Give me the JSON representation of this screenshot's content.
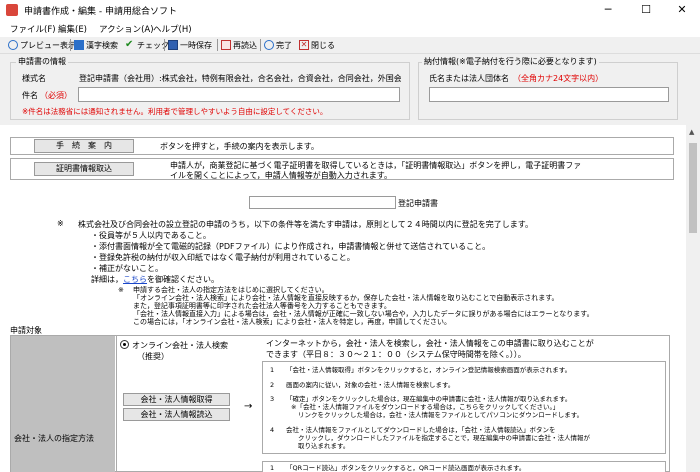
{
  "window": {
    "title": "申請書作成・編集 - 申請用総合ソフト",
    "minimize": "─",
    "maximize": "☐",
    "close": "✕"
  },
  "menu": [
    "ファイル(F)",
    "編集(E)",
    "アクション(A)",
    "ヘルプ(H)"
  ],
  "toolbar": {
    "preview": "プレビュー表示",
    "kanji": "漢字検索",
    "check": "チェック",
    "save": "一時保存",
    "reload": "再読込",
    "done": "完了",
    "close": "閉じる"
  },
  "applicant_info": {
    "legend": "申請書の情報",
    "form_name_label": "様式名",
    "form_name_value": "登記申請書（会社用）:株式会社，特例有限会社，合名会社，合資会社，合同会社，外国会社",
    "subject_label": "件名",
    "required": "（必須）",
    "subject_value": "",
    "note": "※件名は法務省には通知されません。利用者で管理しやすいよう自由に設定してください。"
  },
  "payment_info": {
    "legend": "納付情報(※電子納付を行う際に必要となります)",
    "name_label": "氏名または法人団体名",
    "name_hint": "（全角カナ24文字以内）",
    "name_value": ""
  },
  "content": {
    "guide_button": "手　続　案　内",
    "guide_text": "ボタンを押すと，手続の案内を表示します。",
    "cert_button": "証明書情報取込",
    "cert_text_1": "申請人が，商業登記に基づく電子証明書を取得しているときは，「証明書情報取込」ボタンを押し，電子証明書ファ",
    "cert_text_2": "イルを開くことによって，申請人情報等が自動入力されます。",
    "registration_suffix": "登記申請書",
    "registration_value": "",
    "notice_mark": "※",
    "notice_1": "株式会社及び合同会社の設立登記の申請のうち，以下の条件等を満たす申請は，原則として２４時間以内に登記を完了します。",
    "notice_2": "・役員等が５人以内であること。",
    "notice_3": "・添付書面情報が全て電磁的記録（PDFファイル）により作成され，申請書情報と併せて送信されていること。",
    "notice_4": "・登録免許税の納付が収入印紙ではなく電子納付が利用されていること。",
    "notice_5": "・補正がないこと。",
    "notice_6_pre": "詳細は，",
    "notice_6_link": "こちら",
    "notice_6_post": "を御確認ください。",
    "small_mark": "※",
    "small_1": "申請する会社・法人の指定方法をはじめに選択してください。",
    "small_2": "「オンライン会社・法人検索」により会社・法人情報を直接反映するか，保存した会社・法人情報を取り込むことで自動表示されます。",
    "small_3": "また，登記事項証明書等に印字された会社法人等番号を入力することもできます。",
    "small_4": "「会社・法人情報直接入力」による場合は，会社・法人情報が正確に一致しない場合や，入力したデータに誤りがある場合にはエラーとなります。",
    "small_5": "この場合には，「オンライン会社・法人検索」により会社・法人を特定し，再度，申請してください。",
    "target_label": "申請対象",
    "spec_label": "会社・法人の指定方法",
    "radio_label": "オンライン会社・法人検索",
    "radio_sub": "（推奨）",
    "online_desc_1": "インターネットから，会社・法人を検索し，会社・法人情報をこの申請書に取り込むことが",
    "online_desc_2": "できます（平日８：３０～２１：００（システム保守時間帯を除く。））。",
    "get_button": "会社・法人情報取得",
    "load_button": "会社・法人情報読込",
    "arrow": "→",
    "step_1_no": "1",
    "step_1": "「会社・法人情報取得」ボタンをクリックすると，オンライン登記情報検索画面が表示されます。",
    "step_2_no": "2",
    "step_2": "画面の案内に従い，対象の会社・法人情報を検索します。",
    "step_3_no": "3",
    "step_3a": "「確定」ボタンをクリックした場合は，現在編集中の申請書に会社・法人情報が取り込まれます。",
    "step_3b": "※「会社・法人情報ファイルをダウンロードする場合は，こちらをクリックしてください。」",
    "step_3c": "リンクをクリックした場合は，会社・法人情報をファイルとしてパソコンにダウンロードします。",
    "step_4_no": "4",
    "step_4a": "会社・法人情報をファイルとしてダウンロードした場合は，「会社・法人情報読込」ボタンを",
    "step_4b": "クリックし，ダウンロードしたファイルを指定することで，現在編集中の申請書に会社・法人情報が",
    "step_4c": "取り込まれます。",
    "next_no": "1",
    "next_text": "「QRコード読込」ボタンをクリックすると，QRコード読込画面が表示されます。"
  },
  "colors": {
    "required_red": "#e00000",
    "link_blue": "#1a47c9",
    "left_cell_gray": "#bfbfbf"
  }
}
